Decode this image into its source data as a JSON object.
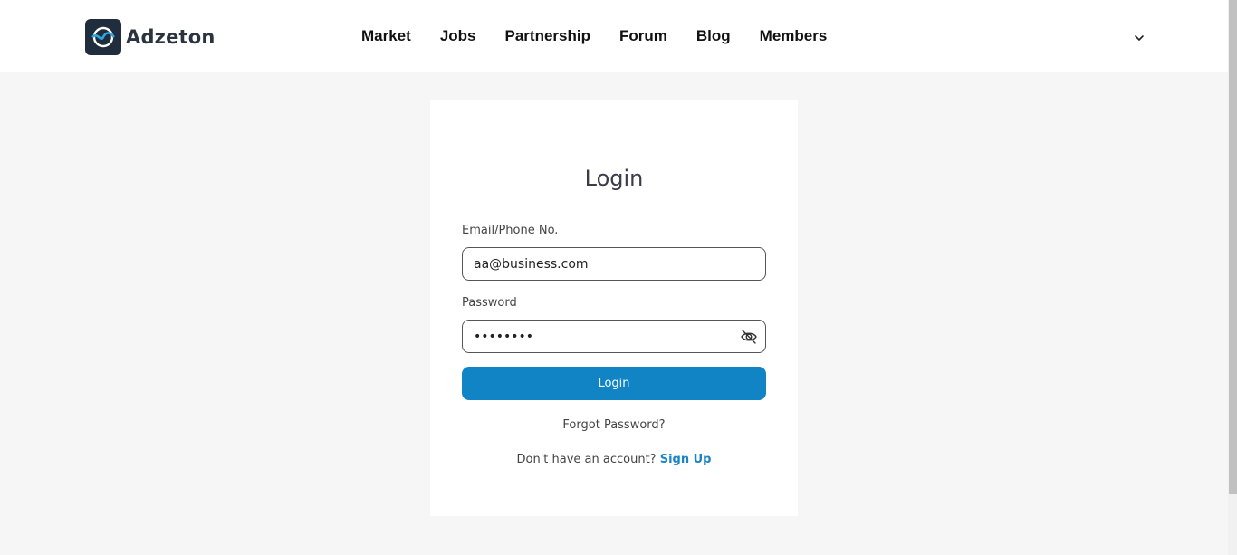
{
  "header": {
    "brand": "Adzeton",
    "nav": [
      {
        "label": "Market"
      },
      {
        "label": "Jobs"
      },
      {
        "label": "Partnership"
      },
      {
        "label": "Forum"
      },
      {
        "label": "Blog"
      },
      {
        "label": "Members"
      }
    ],
    "menu_icon": "chevron-down-icon"
  },
  "login": {
    "title": "Login",
    "email_label": "Email/Phone No.",
    "email_value": "aa@business.com",
    "password_label": "Password",
    "password_value": "••••••••",
    "password_toggle_icon": "eye-off-icon",
    "submit_label": "Login",
    "forgot_label": "Forgot Password?",
    "no_account_text": "Don't have an account?",
    "signup_label": "Sign Up"
  },
  "colors": {
    "accent": "#1084c4",
    "link": "#1a84c7",
    "logo_bg": "#1f2d3d",
    "page_bg": "#f6f6f6"
  }
}
